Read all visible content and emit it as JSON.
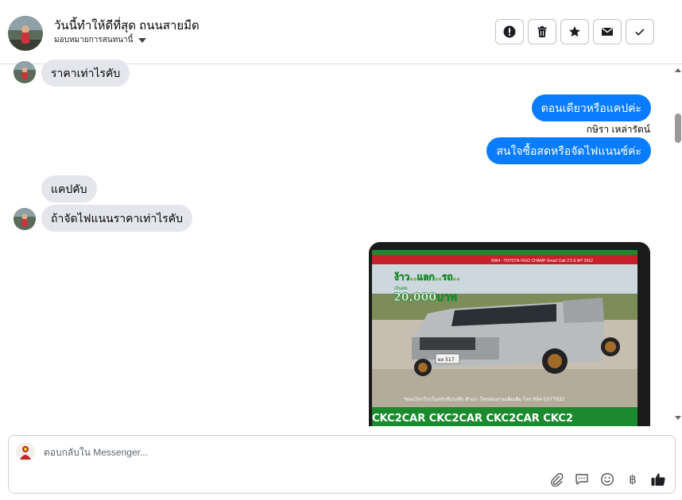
{
  "header": {
    "name": "วันนี้ทำให้ดีที่สุด ถนนสายมืด",
    "assign_label": "มอบหมายการสนทนานี้",
    "actions": [
      {
        "icon": "alert-icon"
      },
      {
        "icon": "trash-icon"
      },
      {
        "icon": "star-icon"
      },
      {
        "icon": "mail-icon"
      },
      {
        "icon": "check-icon"
      }
    ]
  },
  "messages": {
    "m1": "ราคาเท่าไรคับ",
    "m2": "ตอนเดียวหรือแคปค่ะ",
    "sender2": "กษิรา เหล่ารัตน์",
    "m3": "สนใจซื้อสดหรือจัดไฟแนนซ์ค่ะ",
    "m4": "แคปคับ",
    "m5": "ถ้าจัดไฟแนนราคาเท่าไรคับ"
  },
  "ad": {
    "brand": "CKC2CAR CKC2CAR CKC2CAR CKC2",
    "headline": "ง้าว..แลก..รถ..",
    "price_prefix": "เงินสด",
    "price": "20,000บาท",
    "model": "6064 - TOYOTA VIGO CHAMP Smart Cab 2.5 E MT 2012",
    "plate": "ผล 517",
    "contact": "*ผ่อนไหวโปรโมทกับทีมรถดีๆ สำเนา โทรสอบถามเพิ่มเติม โทร 094-5577932"
  },
  "composer": {
    "placeholder": "ตอบกลับใน Messenger...",
    "tools": [
      "paperclip-icon",
      "saved-reply-icon",
      "emoji-icon",
      "baht-icon",
      "like-icon"
    ],
    "baht_symbol": "฿"
  },
  "colors": {
    "outgoing_bubble": "#0a7cff",
    "incoming_bubble": "#e4e6eb",
    "ad_green": "#1b8a2e",
    "ad_red": "#c8202a"
  }
}
